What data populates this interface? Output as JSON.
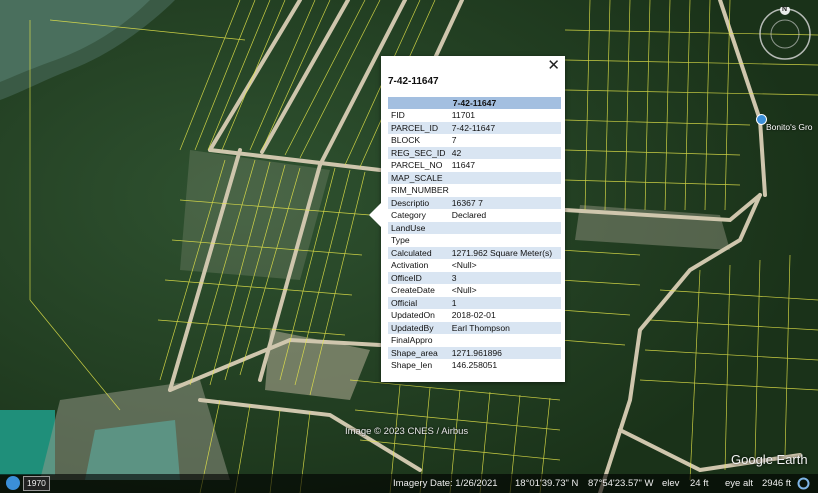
{
  "popup": {
    "title": "7-42-11647",
    "table_header": "7-42-11647",
    "rows": [
      {
        "key": "FID",
        "value": "11701"
      },
      {
        "key": "PARCEL_ID",
        "value": "7-42-11647"
      },
      {
        "key": "BLOCK",
        "value": "7"
      },
      {
        "key": "REG_SEC_ID",
        "value": "42"
      },
      {
        "key": "PARCEL_NO",
        "value": "11647"
      },
      {
        "key": "MAP_SCALE",
        "value": ""
      },
      {
        "key": "RIM_NUMBER",
        "value": ""
      },
      {
        "key": "Descriptio",
        "value": "16367 7"
      },
      {
        "key": "Category",
        "value": "Declared"
      },
      {
        "key": "LandUse",
        "value": ""
      },
      {
        "key": "Type",
        "value": ""
      },
      {
        "key": "Calculated",
        "value": "1271.962 Square Meter(s)"
      },
      {
        "key": "Activation",
        "value": "<Null>"
      },
      {
        "key": "OfficeID",
        "value": "3"
      },
      {
        "key": "CreateDate",
        "value": "<Null>"
      },
      {
        "key": "Official",
        "value": "1"
      },
      {
        "key": "UpdatedOn",
        "value": "2018-02-01"
      },
      {
        "key": "UpdatedBy",
        "value": "Earl Thompson"
      },
      {
        "key": "FinalAppro",
        "value": ""
      },
      {
        "key": "Shape_area",
        "value": "1271.961896"
      },
      {
        "key": "Shape_len",
        "value": "146.258051"
      }
    ]
  },
  "map": {
    "credit": "Image © 2023 CNES / Airbus",
    "logo": "Google Earth",
    "place_label": "Bonito's Gro",
    "compass_letter": "N",
    "colors": {
      "parcel_lines": "#e8e84a",
      "popup_header": "#a3bfe0",
      "row_alt": "#d9e5f2"
    }
  },
  "status": {
    "year": "1970",
    "imagery_date": "Imagery Date: 1/26/2021",
    "lat": "18°01'39.73\" N",
    "lon": "87°54'23.57\" W",
    "elev_label": "elev",
    "elev_value": "24 ft",
    "eye_alt_label": "eye alt",
    "eye_alt_value": "2946 ft"
  }
}
